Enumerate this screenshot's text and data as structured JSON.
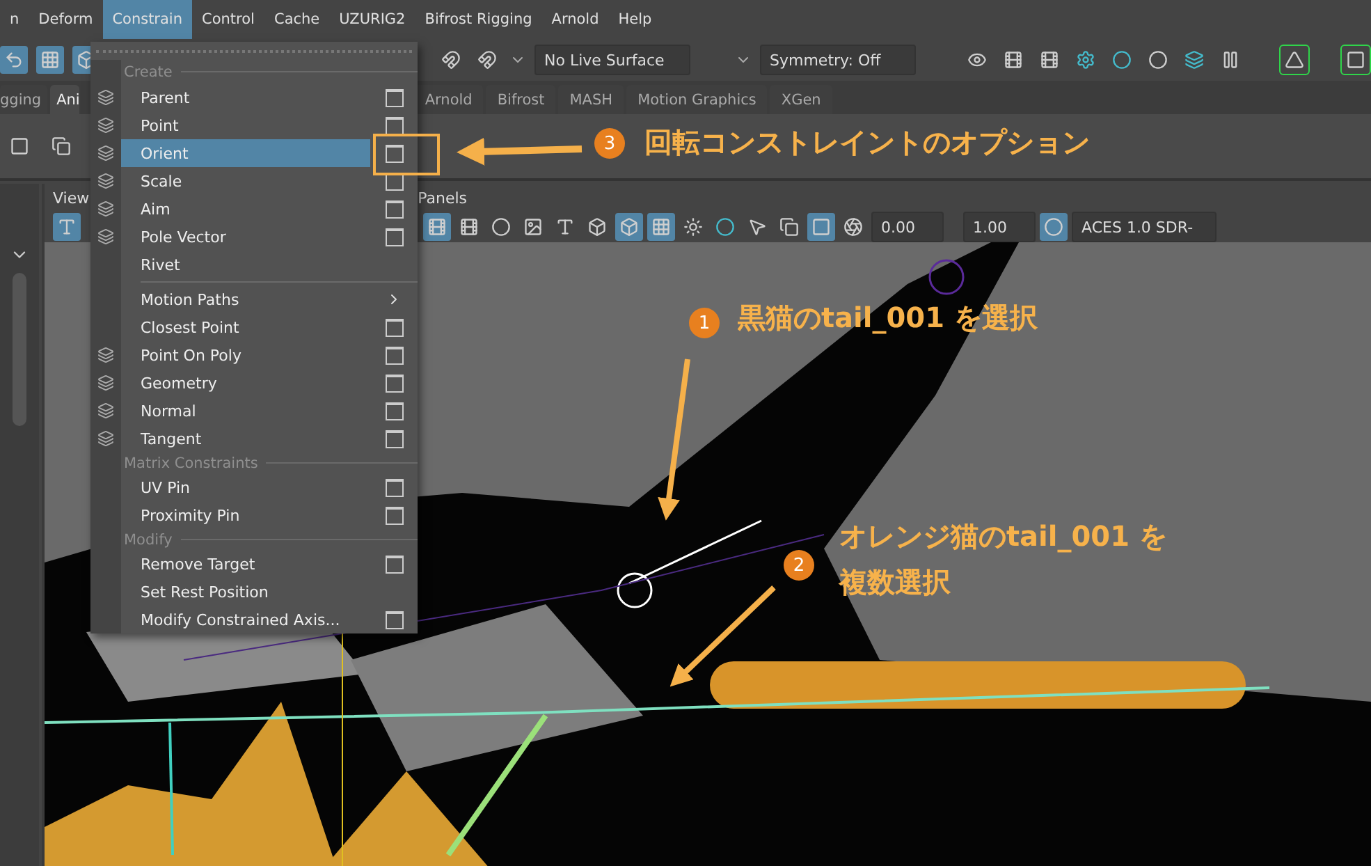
{
  "menu_bar": [
    {
      "label": "n",
      "selected": false
    },
    {
      "label": "Deform",
      "selected": false
    },
    {
      "label": "Constrain",
      "selected": true
    },
    {
      "label": "Control",
      "selected": false
    },
    {
      "label": "Cache",
      "selected": false
    },
    {
      "label": "UZURIG2",
      "selected": false
    },
    {
      "label": "Bifrost Rigging",
      "selected": false
    },
    {
      "label": "Arnold",
      "selected": false
    },
    {
      "label": "Help",
      "selected": false
    }
  ],
  "status_line": {
    "live_surface": "No Live Surface",
    "symmetry": "Symmetry: Off"
  },
  "shelf_tabs": [
    {
      "label": "gging",
      "selected": false
    },
    {
      "label": "Ani",
      "selected": true
    },
    {
      "label": "Arnold",
      "selected": false
    },
    {
      "label": "Bifrost",
      "selected": false
    },
    {
      "label": "MASH",
      "selected": false
    },
    {
      "label": "Motion Graphics",
      "selected": false
    },
    {
      "label": "XGen",
      "selected": false
    }
  ],
  "constrain_menu": {
    "sections": [
      {
        "heading": "Create",
        "items": [
          {
            "label": "Parent",
            "has_icon": true,
            "options": true,
            "submenu": false,
            "selected": false
          },
          {
            "label": "Point",
            "has_icon": true,
            "options": true,
            "submenu": false,
            "selected": false
          },
          {
            "label": "Orient",
            "has_icon": true,
            "options": true,
            "submenu": false,
            "selected": true
          },
          {
            "label": "Scale",
            "has_icon": true,
            "options": true,
            "submenu": false,
            "selected": false
          },
          {
            "label": "Aim",
            "has_icon": true,
            "options": true,
            "submenu": false,
            "selected": false
          },
          {
            "label": "Pole Vector",
            "has_icon": true,
            "options": true,
            "submenu": false,
            "selected": false
          },
          {
            "label": "Rivet",
            "has_icon": false,
            "options": false,
            "submenu": false,
            "selected": false
          }
        ]
      },
      {
        "items": [
          {
            "label": "Motion Paths",
            "has_icon": false,
            "options": false,
            "submenu": true,
            "selected": false
          },
          {
            "label": "Closest Point",
            "has_icon": false,
            "options": true,
            "submenu": false,
            "selected": false
          },
          {
            "label": "Point On Poly",
            "has_icon": true,
            "options": true,
            "submenu": false,
            "selected": false
          },
          {
            "label": "Geometry",
            "has_icon": true,
            "options": true,
            "submenu": false,
            "selected": false
          },
          {
            "label": "Normal",
            "has_icon": true,
            "options": true,
            "submenu": false,
            "selected": false
          },
          {
            "label": "Tangent",
            "has_icon": true,
            "options": true,
            "submenu": false,
            "selected": false
          }
        ]
      },
      {
        "heading": "Matrix Constraints",
        "items": [
          {
            "label": "UV Pin",
            "has_icon": false,
            "options": true,
            "submenu": false,
            "selected": false
          },
          {
            "label": "Proximity Pin",
            "has_icon": false,
            "options": true,
            "submenu": false,
            "selected": false
          }
        ]
      },
      {
        "heading": "Modify",
        "items": [
          {
            "label": "Remove Target",
            "has_icon": false,
            "options": true,
            "submenu": false,
            "selected": false
          },
          {
            "label": "Set Rest Position",
            "has_icon": false,
            "options": false,
            "submenu": false,
            "selected": false
          },
          {
            "label": "Modify Constrained Axis...",
            "has_icon": false,
            "options": true,
            "submenu": false,
            "selected": false
          }
        ]
      }
    ]
  },
  "viewport": {
    "menu": [
      "View",
      "Panels"
    ],
    "exposure": "0.00",
    "gamma": "1.00",
    "color_space": "ACES 1.0 SDR-"
  },
  "annotations": [
    {
      "number": "3",
      "lines": [
        "回転コンストレイントのオプション"
      ]
    },
    {
      "number": "1",
      "lines": [
        "黒猫のtail_001 を選択"
      ]
    },
    {
      "number": "2",
      "lines": [
        "オレンジ猫のtail_001 を",
        "複数選択"
      ]
    }
  ]
}
